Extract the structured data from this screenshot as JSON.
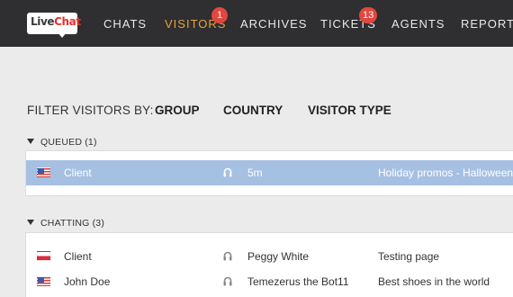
{
  "brand": {
    "name_part1": "Live",
    "name_part2": "Chat"
  },
  "nav": {
    "chats": "CHATS",
    "visitors": "VISITORS",
    "visitors_badge": "1",
    "archives": "ARCHIVES",
    "tickets": "TICKETS",
    "tickets_badge": "13",
    "agents": "AGENTS",
    "reports": "REPORTS"
  },
  "filter": {
    "label": "FILTER VISITORS BY:",
    "options": [
      "GROUP",
      "COUNTRY",
      "VISITOR TYPE"
    ]
  },
  "queued": {
    "header": "QUEUED (1)",
    "rows": [
      {
        "name": "Client",
        "flag": "us-flag-icon",
        "info": "5m",
        "page": "Holiday promos - Halloween"
      }
    ]
  },
  "chatting": {
    "header": "CHATTING (3)",
    "rows": [
      {
        "name": "Client",
        "flag": "pl-flag-icon",
        "agent": "Peggy White",
        "page": "Testing page"
      },
      {
        "name": "John Doe",
        "flag": "us-flag-icon",
        "agent": "Temezerus the Bot11",
        "page": "Best shoes in the world"
      }
    ]
  },
  "colors": {
    "topbar": "#2f2e30",
    "active_nav": "#e8a23e",
    "badge": "#e2463f",
    "selected_row": "#a6c0e2"
  }
}
